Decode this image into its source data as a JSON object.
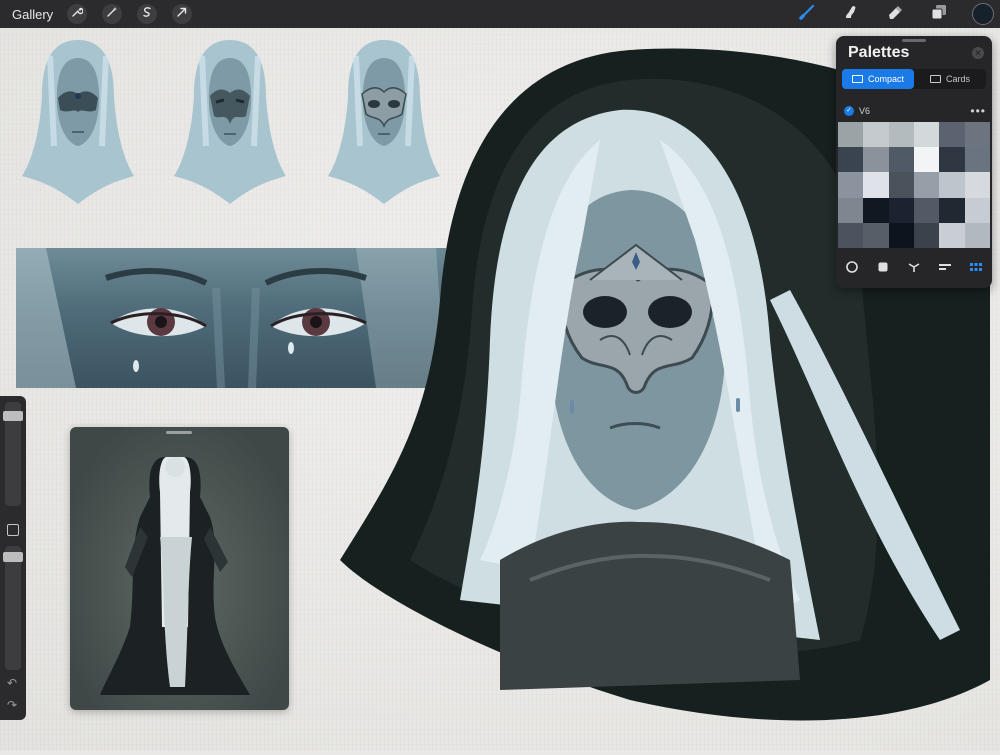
{
  "toolbar": {
    "gallery_label": "Gallery",
    "left_tools": [
      {
        "name": "wrench-icon"
      },
      {
        "name": "magic-wand-icon"
      },
      {
        "name": "selection-icon"
      },
      {
        "name": "transform-arrow-icon"
      }
    ],
    "right_tools": [
      {
        "name": "brush-icon",
        "active": true
      },
      {
        "name": "smudge-icon",
        "active": false
      },
      {
        "name": "eraser-icon",
        "active": false
      },
      {
        "name": "layers-icon",
        "active": false
      }
    ],
    "current_color": "#16212b",
    "accent_color": "#1a7be8"
  },
  "palettes": {
    "title": "Palettes",
    "close_glyph": "✕",
    "tabs": [
      {
        "label": "Compact",
        "active": true
      },
      {
        "label": "Cards",
        "active": false
      }
    ],
    "palette_name": "V6",
    "more_glyph": "•••",
    "swatches": [
      "#9aa4a6",
      "#c4cacd",
      "#b4bbbf",
      "#d3d8db",
      "#5c6370",
      "#6c7480",
      "#3a4350",
      "#8b929c",
      "#505a66",
      "#f2f4f6",
      "#2f3742",
      "#6a7380",
      "#8a939e",
      "#dfe3e9",
      "#4a525c",
      "#969ea8",
      "#bfc5cc",
      "#d6dadf",
      "#7e8690",
      "#101822",
      "#1b2330",
      "#525a66",
      "#202832",
      "#c7ccd2",
      "#4b535f",
      "#585e68",
      "#0d141e",
      "#3b424c",
      "#c9ced4",
      "#b2b8bf"
    ],
    "footer_tools": [
      {
        "name": "disc-icon"
      },
      {
        "name": "classic-icon"
      },
      {
        "name": "harmony-icon"
      },
      {
        "name": "value-icon"
      },
      {
        "name": "palette-grid-icon",
        "active": true
      }
    ]
  },
  "sidebar": {
    "brush_size_level": 0.9,
    "opacity_level": 0.95,
    "undo_glyph": "↶",
    "redo_glyph": "↷"
  }
}
